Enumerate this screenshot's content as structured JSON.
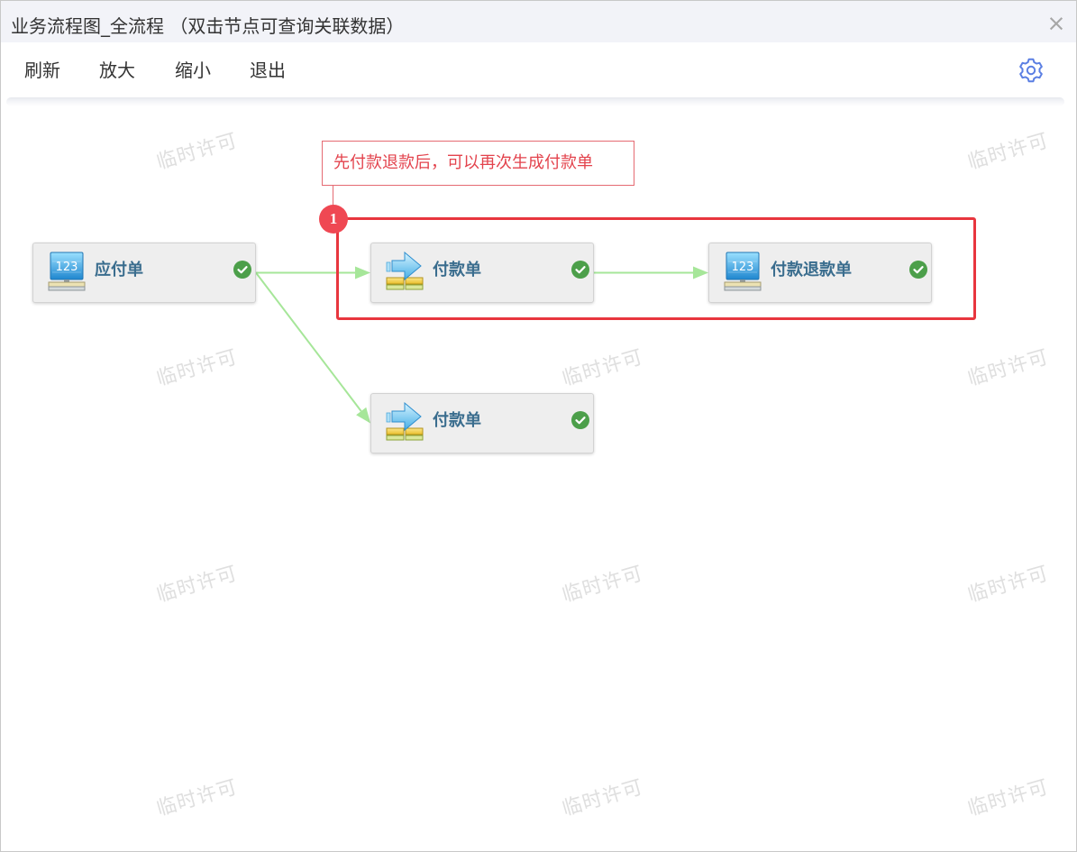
{
  "dialog": {
    "title": "业务流程图_全流程 （双击节点可查询关联数据）",
    "close_label": "×",
    "close_icon": "close-icon"
  },
  "toolbar": {
    "items": [
      {
        "label": "刷新"
      },
      {
        "label": "放大"
      },
      {
        "label": "缩小"
      },
      {
        "label": "退出"
      }
    ],
    "settings_icon": "gear-icon"
  },
  "watermark": {
    "text": "临时许可"
  },
  "flow": {
    "nodes": [
      {
        "label": "应付单",
        "icon": "monitor-123-icon",
        "icon_text": "123",
        "status_icon": "check-circle-icon"
      },
      {
        "label": "付款单",
        "icon": "payment-arrow-icon",
        "status_icon": "check-circle-icon"
      },
      {
        "label": "付款退款单",
        "icon": "monitor-123-icon",
        "icon_text": "123",
        "status_icon": "check-circle-icon"
      },
      {
        "label": "付款单",
        "icon": "payment-arrow-icon",
        "status_icon": "check-circle-icon"
      }
    ],
    "edges": [
      {
        "from": 0,
        "to": 1
      },
      {
        "from": 1,
        "to": 2
      },
      {
        "from": 0,
        "to": 3
      }
    ]
  },
  "annotation": {
    "badge": "1",
    "text": "先付款退款后，可以再次生成付款单"
  },
  "colors": {
    "accent": "#5b7fe3",
    "node_text": "#3a6d8e",
    "status_ok": "#4c9f4a",
    "edge": "#a6e699",
    "highlight": "#e8363e",
    "annotation_text": "#e3434d"
  }
}
